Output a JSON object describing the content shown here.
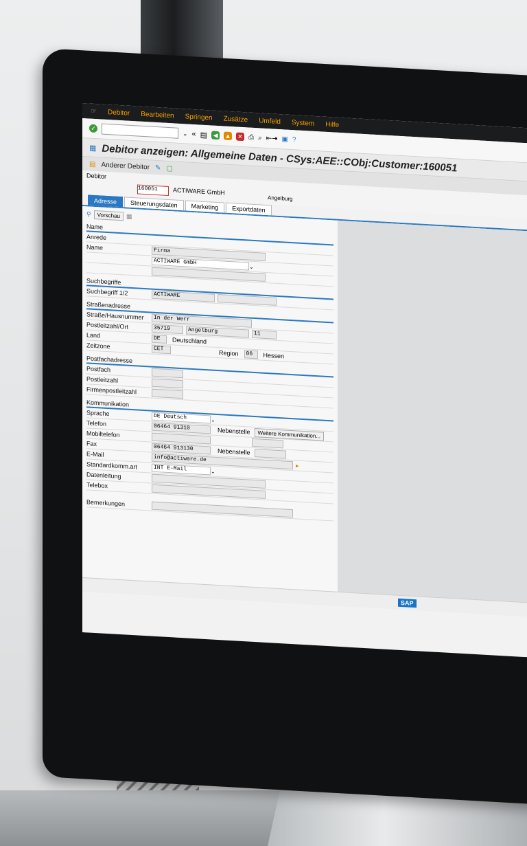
{
  "menu": [
    "Debitor",
    "Bearbeiten",
    "Springen",
    "Zusätze",
    "Umfeld",
    "System",
    "Hilfe"
  ],
  "title": "Debitor anzeigen: Allgemeine Daten - CSys:AEE::CObj:Customer:160051",
  "appbar": {
    "other_customer": "Anderer Debitor"
  },
  "header": {
    "label": "Debitor",
    "number": "160051",
    "name": "ACTIWARE GmbH",
    "city": "Angelburg"
  },
  "tabs": [
    "Adresse",
    "Steuerungsdaten",
    "Marketing",
    "Exportdaten"
  ],
  "preview": "Vorschau",
  "form": {
    "name_section": "Name",
    "anrede": "Anrede",
    "name_label": "Name",
    "anrede_value": "Firma",
    "name_value": "ACTIWARE GmbH",
    "search_section": "Suchbegriffe",
    "search_label": "Suchbegriff 1/2",
    "search_value": "ACTIWARE",
    "street_section": "Straßenadresse",
    "street_label": "Straße/Hausnummer",
    "street_value": "In der Werr",
    "zip_label": "Postleitzahl/Ort",
    "zip_value": "35719",
    "city_value": "Angelburg",
    "house_value": "11",
    "country_label": "Land",
    "country_code": "DE",
    "country_name": "Deutschland",
    "region_label": "Region",
    "region_code": "06",
    "region_name": "Hessen",
    "tz_label": "Zeitzone",
    "tz_value": "CET",
    "pobox_section": "Postfachadresse",
    "pobox_label": "Postfach",
    "pobox_zip_label": "Postleitzahl",
    "company_zip_label": "Firmenpostleitzahl",
    "comm_section": "Kommunikation",
    "lang_label": "Sprache",
    "lang_value": "DE Deutsch",
    "phone_label": "Telefon",
    "phone_value": "06464 91310",
    "ext_label": "Nebenstelle",
    "more_comm": "Weitere Kommunikation...",
    "mobile_label": "Mobiltelefon",
    "fax_label": "Fax",
    "fax_value": "06464 913130",
    "email_label": "E-Mail",
    "email_value": "info@actiware.de",
    "stdcomm_label": "Standardkomm.art",
    "stdcomm_value": "INT E-Mail",
    "dataline_label": "Datenleitung",
    "telebox_label": "Telebox",
    "remarks_label": "Bemerkungen"
  },
  "footer": {
    "brand": "SAP"
  }
}
